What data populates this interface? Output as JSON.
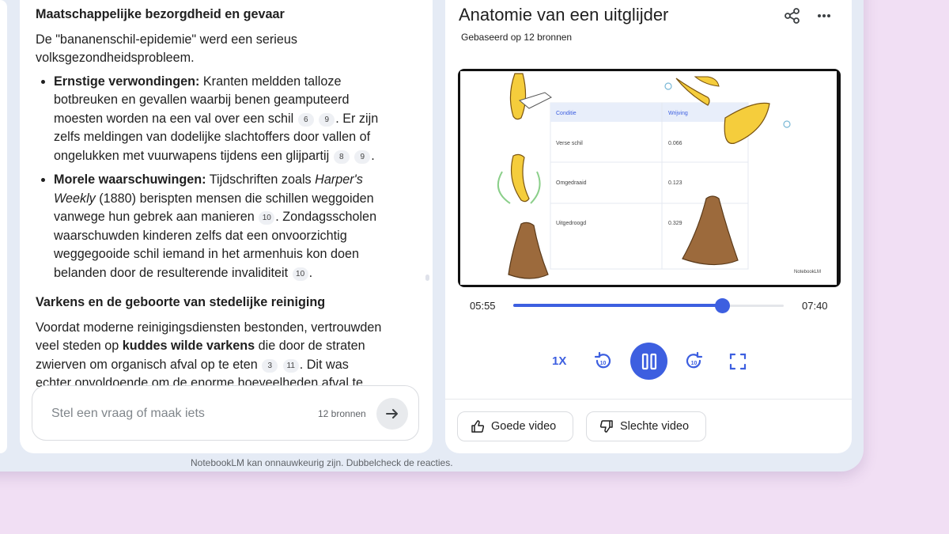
{
  "chat": {
    "heading1": "Maatschappelijke bezorgdheid en gevaar",
    "intro": "De \"bananenschil-epidemie\" werd een serieus volksgezondheidsprobleem.",
    "bullet1": {
      "label": "Ernstige verwondingen:",
      "text_a": " Kranten meldden talloze botbreuken en gevallen waarbij benen geamputeerd moesten worden na een val over een schil ",
      "cite_a1": "6",
      "cite_a2": "9",
      "text_b": ". Er zijn zelfs meldingen van dodelijke slachtoffers door vallen of ongelukken met vuurwapens tijdens een glijpartij ",
      "cite_b1": "8",
      "cite_b2": "9",
      "text_c": "."
    },
    "bullet2": {
      "label": "Morele waarschuwingen:",
      "text_a": " Tijdschriften zoals ",
      "italic": "Harper's Weekly",
      "text_b": " (1880) berispten mensen die schillen weggoiden vanwege hun gebrek aan manieren ",
      "cite_b1": "10",
      "text_c": ". Zondagsscholen waarschuwden kinderen zelfs dat een onvoorzichtig weggegooide schil iemand in het armenhuis kon doen belanden door de resulterende invaliditeit ",
      "cite_c1": "10",
      "text_d": "."
    },
    "heading2": "Varkens en de geboorte van stedelijke reiniging",
    "para2": {
      "text_a": "Voordat moderne reinigingsdiensten bestonden, vertrouwden veel steden op ",
      "bold": "kuddes wilde varkens",
      "text_b": " die door de straten zwierven om organisch afval op te eten ",
      "cite_1": "3",
      "cite_2": "11",
      "text_c": ". Dit was echter onvoldoende om de enorme hoeveelheden afval te beheersen"
    },
    "input_placeholder": "Stel een vraag of maak iets",
    "sources_count": "12 bronnen"
  },
  "panel": {
    "title": "Anatomie van een uitglijder",
    "subtitle": "Gebaseerd op 12 bronnen",
    "video": {
      "col_condition": "Conditie",
      "col_friction": "Wrijving",
      "rows": [
        {
          "condition": "Verse schil",
          "value": "0.066"
        },
        {
          "condition": "Omgedraaid",
          "value": "0.123"
        },
        {
          "condition": "Uitgedroogd",
          "value": "0.329"
        }
      ],
      "watermark": "NotebookLM"
    },
    "current_time": "05:55",
    "total_time": "07:40",
    "progress_fraction": 0.771,
    "speed": "1X",
    "good_video": "Goede video",
    "bad_video": "Slechte video"
  },
  "disclaimer": "NotebookLM kan onnauwkeurig zijn. Dubbelcheck de reacties.",
  "colors": {
    "accent": "#3d5fe0",
    "page_bg": "#f1dff4",
    "frame_bg": "#e5ebf5"
  }
}
